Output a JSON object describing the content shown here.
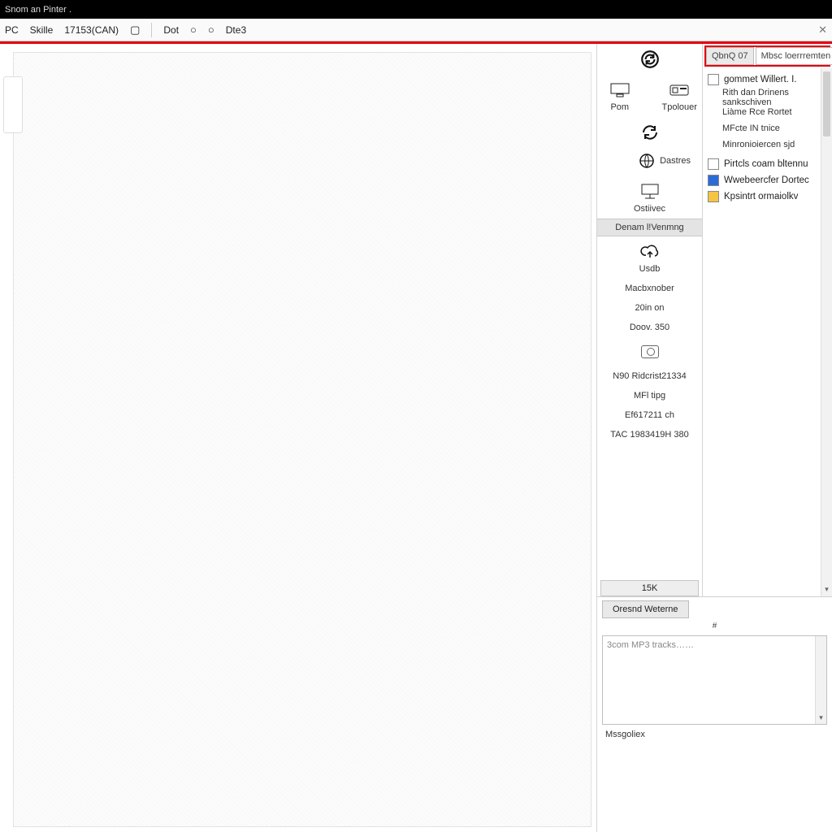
{
  "title": "Snom an Pinter .",
  "toolbar": {
    "t1": "PC",
    "t2": "Skille",
    "t3": "17153(CAN)",
    "t4": "Dot",
    "t5": "Dte3"
  },
  "paletteA": {
    "row1": {
      "pom": "Pom",
      "tpolouer": "Tpolouer"
    },
    "cells": {
      "dastes": "Dastres",
      "ostinec": "Ostiivec"
    },
    "section_header": "Denam l!Venmng",
    "usdb": "Usdb",
    "items": {
      "a": "Macbxnober",
      "b": "20in on",
      "c": "Doov. 350",
      "d": "N90 Ridcrist21334",
      "e": "MFl tipg",
      "f": "Ef617211 ch",
      "g": "TAC 1983419H 380"
    },
    "count": "15K"
  },
  "paletteB": {
    "tab1": "QbnQ 07",
    "tab2": "Mbsc loerrremten",
    "cats": {
      "c0": "gommet Willert. I.",
      "c1": "Rith dan Drinens",
      "c2": "sankschiven",
      "c3": "Liàme Rce Rortet",
      "c4": "MFcte IN tnice",
      "c5": "Minronioiercen sjd",
      "c6": "Pirtcls coam bltennu",
      "c7": "Wwebeercfer Dortec",
      "c8": "Kpsintrt ormaiolkv"
    }
  },
  "lower": {
    "btn": "Oresnd Weterne",
    "sort_glyph": "#",
    "search_placeholder": "3com MP3 tracks……",
    "status": "Mssgoliex"
  }
}
